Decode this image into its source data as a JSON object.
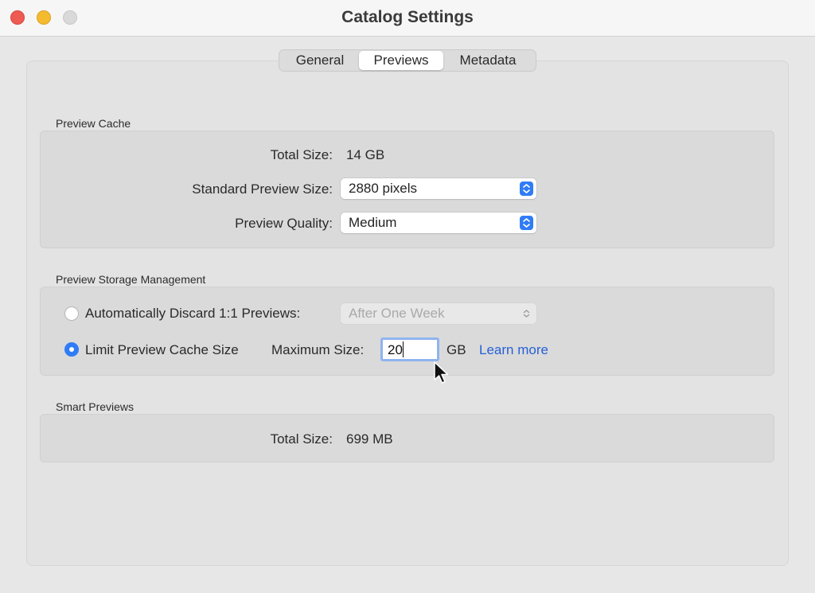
{
  "window": {
    "title": "Catalog Settings"
  },
  "tabs": [
    {
      "label": "General",
      "selected": false
    },
    {
      "label": "Previews",
      "selected": true
    },
    {
      "label": "Metadata",
      "selected": false
    }
  ],
  "preview_cache": {
    "section_label": "Preview Cache",
    "total_size_label": "Total Size:",
    "total_size_value": "14 GB",
    "standard_preview_size_label": "Standard Preview Size:",
    "standard_preview_size_value": "2880 pixels",
    "preview_quality_label": "Preview Quality:",
    "preview_quality_value": "Medium"
  },
  "storage": {
    "section_label": "Preview Storage Management",
    "auto_discard_label": "Automatically Discard 1:1 Previews:",
    "auto_discard_value": "After One Week",
    "limit_label": "Limit Preview Cache Size",
    "max_size_label": "Maximum Size:",
    "max_size_value": "20",
    "unit": "GB",
    "learn_more": "Learn more",
    "selected_option": "limit"
  },
  "smart_previews": {
    "section_label": "Smart Previews",
    "total_size_label": "Total Size:",
    "total_size_value": "699 MB"
  },
  "colors": {
    "accent": "#2f7cf6",
    "link": "#2660d6"
  }
}
